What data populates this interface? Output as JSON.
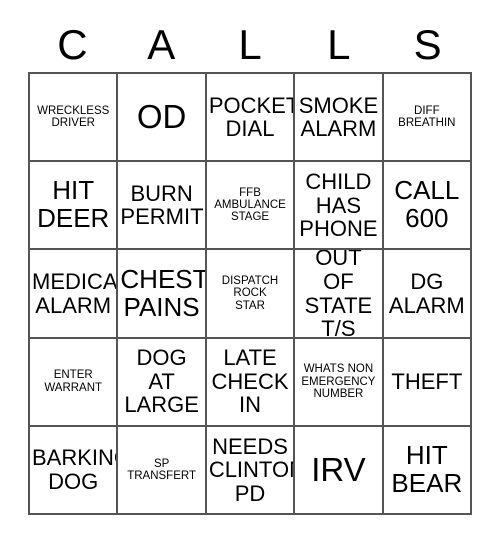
{
  "card": {
    "header_letters": [
      "C",
      "A",
      "L",
      "L",
      "S"
    ],
    "colors": {
      "text": "#000000",
      "grid_line": "#555555",
      "background": "#ffffff"
    },
    "rows": [
      [
        {
          "text": "WRECKLESS\nDRIVER",
          "size": "small"
        },
        {
          "text": "OD",
          "size": "xlarge"
        },
        {
          "text": "POCKET\nDIAL",
          "size": "medium"
        },
        {
          "text": "SMOKE\nALARM",
          "size": "medium"
        },
        {
          "text": "DIFF\nBREATHIN",
          "size": "small"
        }
      ],
      [
        {
          "text": "HIT\nDEER",
          "size": "large"
        },
        {
          "text": "BURN\nPERMIT",
          "size": "medium"
        },
        {
          "text": "FFB\nAMBULANCE\nSTAGE",
          "size": "small"
        },
        {
          "text": "CHILD\nHAS\nPHONE",
          "size": "medium"
        },
        {
          "text": "CALL\n600",
          "size": "large"
        }
      ],
      [
        {
          "text": "MEDICAL\nALARM",
          "size": "medium"
        },
        {
          "text": "CHEST\nPAINS",
          "size": "large"
        },
        {
          "text": "DISPATCH\nROCK\nSTAR",
          "size": "small"
        },
        {
          "text": "OUT OF\nSTATE\nT/S",
          "size": "medium"
        },
        {
          "text": "DG\nALARM",
          "size": "medium"
        }
      ],
      [
        {
          "text": "ENTER\nWARRANT",
          "size": "small"
        },
        {
          "text": "DOG\nAT\nLARGE",
          "size": "medium"
        },
        {
          "text": "LATE\nCHECK\nIN",
          "size": "medium"
        },
        {
          "text": "WHATS NON\nEMERGENCY\nNUMBER",
          "size": "small"
        },
        {
          "text": "THEFT",
          "size": "medium"
        }
      ],
      [
        {
          "text": "BARKING\nDOG",
          "size": "medium"
        },
        {
          "text": "SP\nTRANSFERT",
          "size": "small"
        },
        {
          "text": "NEEDS\nCLINTON\nPD",
          "size": "medium"
        },
        {
          "text": "IRV",
          "size": "xlarge"
        },
        {
          "text": "HIT\nBEAR",
          "size": "large"
        }
      ]
    ]
  }
}
